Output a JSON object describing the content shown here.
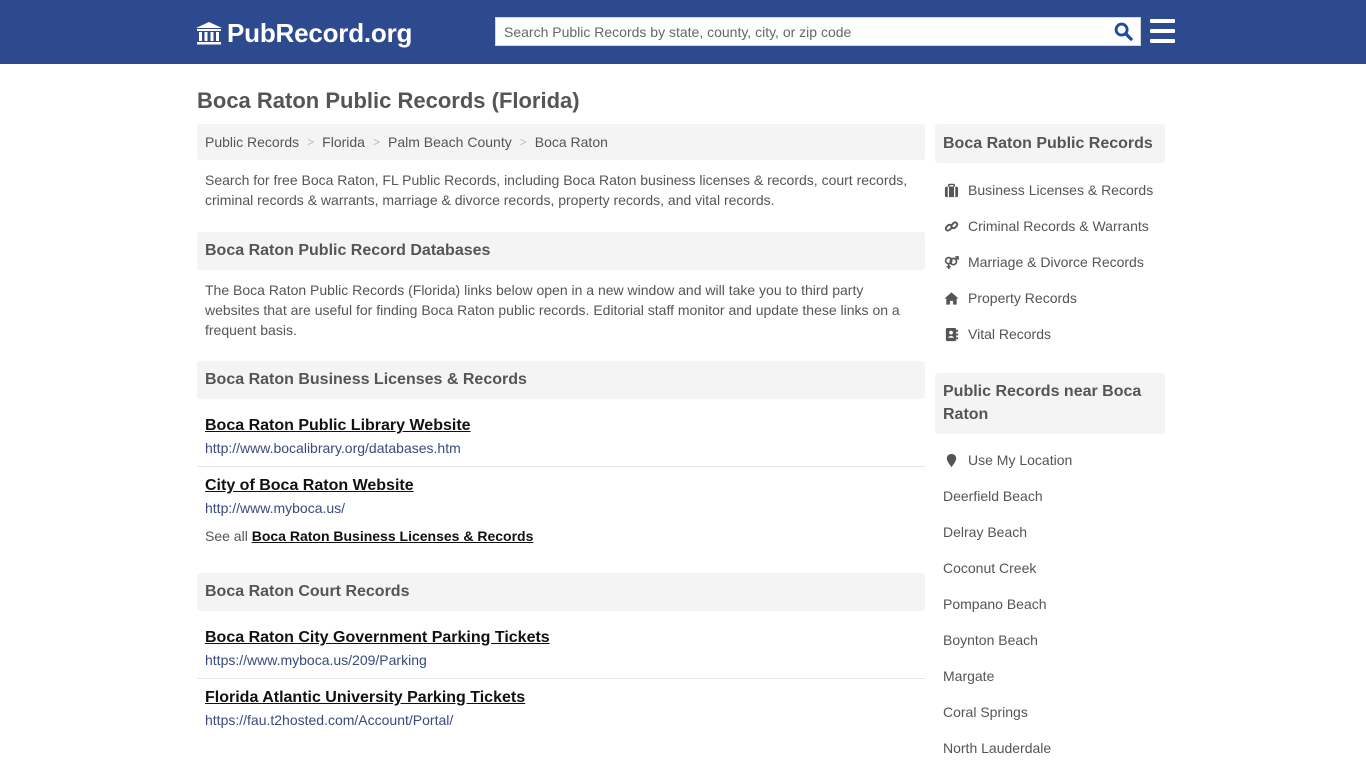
{
  "header": {
    "logo_text": "PubRecord.org",
    "search_placeholder": "Search Public Records by state, county, city, or zip code",
    "search_value": "",
    "colors": {
      "bar": "#2e4a8f",
      "search_icon": "#1b4f9c"
    }
  },
  "page": {
    "title": "Boca Raton Public Records (Florida)"
  },
  "breadcrumb": [
    {
      "label": "Public Records"
    },
    {
      "label": "Florida"
    },
    {
      "label": "Palm Beach County"
    },
    {
      "label": "Boca Raton"
    }
  ],
  "breadcrumb_separator": ">",
  "main": {
    "intro": "Search for free Boca Raton, FL Public Records, including Boca Raton business licenses & records, court records, criminal records & warrants, marriage & divorce records, property records, and vital records.",
    "databases_heading": "Boca Raton Public Record Databases",
    "databases_text": "The Boca Raton Public Records (Florida) links below open in a new window and will take you to third party websites that are useful for finding Boca Raton public records. Editorial staff monitor and update these links on a frequent basis.",
    "sections": [
      {
        "heading": "Boca Raton Business Licenses & Records",
        "links": [
          {
            "title": "Boca Raton Public Library Website",
            "url": "http://www.bocalibrary.org/databases.htm"
          },
          {
            "title": "City of Boca Raton Website",
            "url": "http://www.myboca.us/"
          }
        ],
        "see_all_prefix": "See all",
        "see_all_link": "Boca Raton Business Licenses & Records"
      },
      {
        "heading": "Boca Raton Court Records",
        "links": [
          {
            "title": "Boca Raton City Government Parking Tickets",
            "url": "https://www.myboca.us/209/Parking"
          },
          {
            "title": "Florida Atlantic University Parking Tickets",
            "url": "https://fau.t2hosted.com/Account/Portal/"
          }
        ]
      }
    ]
  },
  "sidebar": {
    "records_heading": "Boca Raton Public Records",
    "records_items": [
      {
        "label": "Business Licenses & Records",
        "icon": "briefcase-icon"
      },
      {
        "label": "Criminal Records & Warrants",
        "icon": "link-icon"
      },
      {
        "label": "Marriage & Divorce Records",
        "icon": "gender-icon"
      },
      {
        "label": "Property Records",
        "icon": "home-icon"
      },
      {
        "label": "Vital Records",
        "icon": "address-book-icon"
      }
    ],
    "nearby_heading": "Public Records near Boca Raton",
    "use_location": "Use My Location",
    "nearby_cities": [
      "Deerfield Beach",
      "Delray Beach",
      "Coconut Creek",
      "Pompano Beach",
      "Boynton Beach",
      "Margate",
      "Coral Springs",
      "North Lauderdale"
    ]
  }
}
